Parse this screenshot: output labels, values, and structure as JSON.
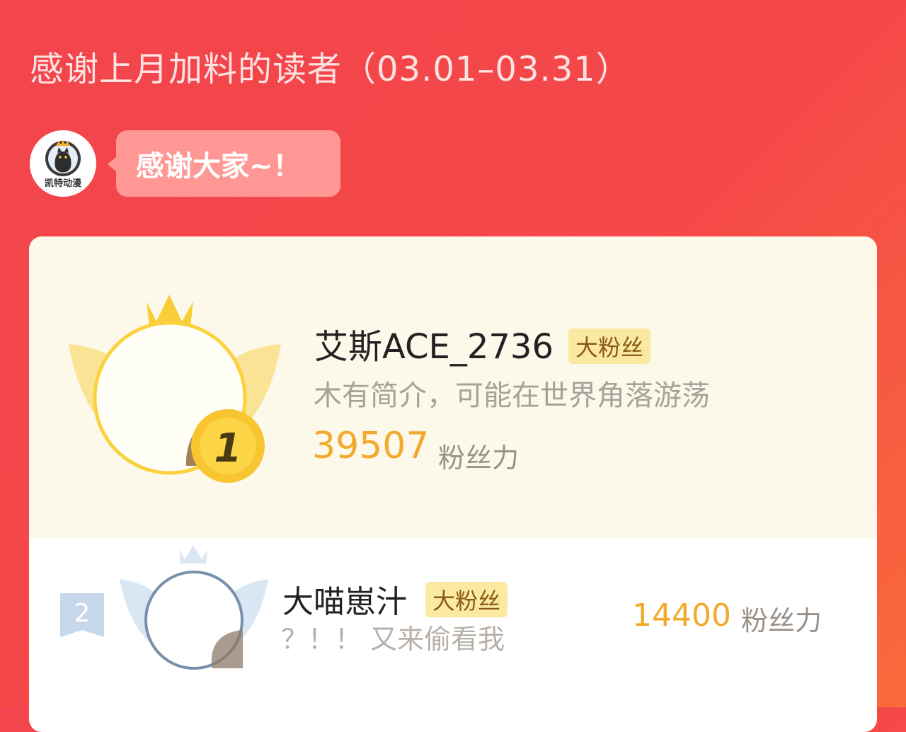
{
  "header": {
    "title": "感谢上月加料的读者（03.01–03.31）"
  },
  "brand": {
    "avatar_label": "凯特动漫",
    "bubble_text": "感谢大家~！"
  },
  "leaderboard": [
    {
      "rank": "1",
      "name": "艾斯ACE_2736",
      "badge": "大粉丝",
      "bio": "木有简介，可能在世界角落游荡",
      "score": "39507",
      "score_unit": "粉丝力"
    },
    {
      "rank": "2",
      "name": "大喵崽汁",
      "badge": "大粉丝",
      "bio": "？！！ 又来偷看我",
      "score": "14400",
      "score_unit": "粉丝力"
    }
  ],
  "colors": {
    "background": "#f2454d",
    "score": "#f3a92d",
    "badge_bg": "#fbe9a2",
    "card_top": "#fdf9ea"
  }
}
